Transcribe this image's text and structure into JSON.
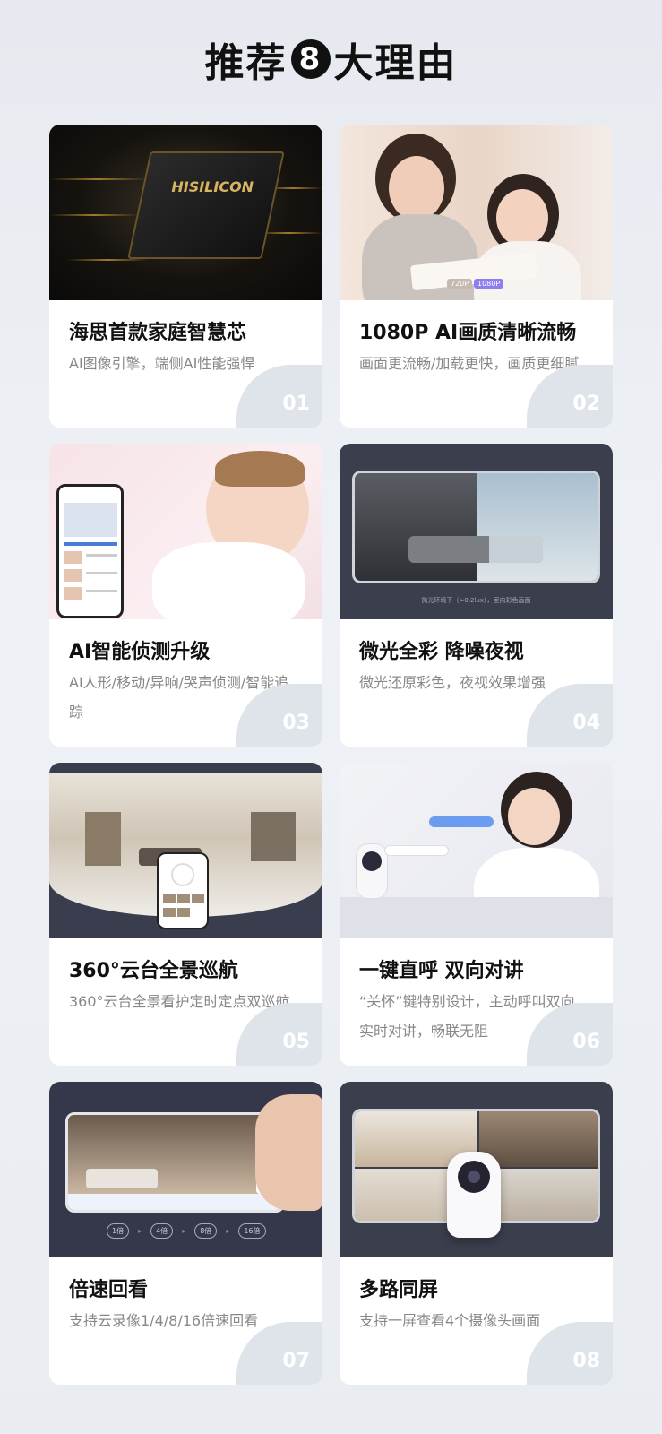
{
  "header": {
    "title_pre": "推荐",
    "title_num": "8",
    "title_post": "大理由"
  },
  "cards": [
    {
      "title": "海思首款家庭智慧芯",
      "desc": "AI图像引擎，端侧AI性能强悍",
      "num": "01",
      "image_text": "HISILICON"
    },
    {
      "title": "1080P AI画质清晰流畅",
      "desc": "画面更流畅/加载更快，画质更细腻",
      "num": "02",
      "image_tags": [
        "720P",
        "1080P"
      ]
    },
    {
      "title": "AI智能侦测升级",
      "desc": "AI人形/移动/异响/哭声侦测/智能追踪",
      "num": "03"
    },
    {
      "title": "微光全彩 降噪夜视",
      "desc": "微光还原彩色，夜视效果增强",
      "num": "04",
      "image_caption": "微光环境下（≈0.2lux），室内彩色画面"
    },
    {
      "title": "360°云台全景巡航",
      "desc": "360°云台全景看护定时定点双巡航",
      "num": "05"
    },
    {
      "title": "一键直呼 双向对讲",
      "desc": "“关怀”键特别设计，主动呼叫双向实时对讲，畅联无阻",
      "num": "06"
    },
    {
      "title": "倍速回看",
      "desc": "支持云录像1/4/8/16倍速回看",
      "num": "07",
      "speeds": [
        "1倍",
        "4倍",
        "8倍",
        "16倍"
      ],
      "speed_menu": [
        "1x",
        "4x",
        "8x",
        "16x"
      ]
    },
    {
      "title": "多路同屏",
      "desc": "支持一屏查看4个摄像头画面",
      "num": "08"
    }
  ],
  "colors": {
    "badge": "#dfe3ea",
    "title": "#111111",
    "desc": "#888888",
    "accent_gold": "#d8b462"
  }
}
